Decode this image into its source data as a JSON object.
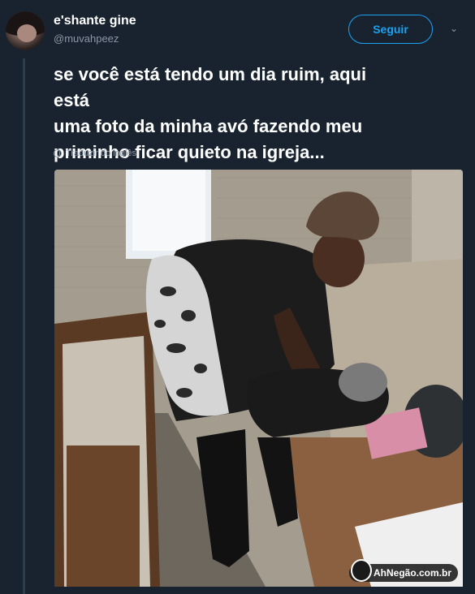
{
  "tweet": {
    "display_name": "e'shante gine",
    "handle": "@muvahpeez",
    "follow_label": "Seguir",
    "text_lines": [
      "se você está tendo um dia ruim, aqui está",
      "uma foto da minha avó fazendo meu",
      "priminho ficar quieto na igreja..."
    ],
    "translate_label": "Traduzir do inglês"
  },
  "photo": {
    "watermark": "AhNegão.com.br"
  },
  "icons": {
    "caret": "chevron-down-icon",
    "globe": "globe-icon"
  },
  "colors": {
    "background": "#18232f",
    "accent": "#1da1f2",
    "muted": "#8a97a5"
  }
}
